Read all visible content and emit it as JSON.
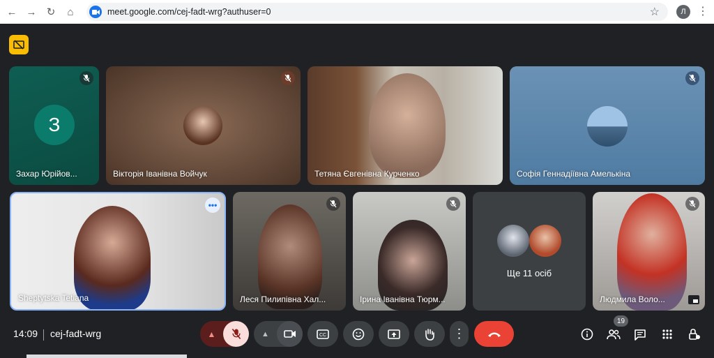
{
  "browser": {
    "url": "meet.google.com/cej-fadt-wrg?authuser=0",
    "profile_initial": "Л"
  },
  "tiles": [
    {
      "name": "Захар Юрійов...",
      "initial": "З"
    },
    {
      "name": "Вікторія Іванівна Войчук"
    },
    {
      "name": "Тетяна Євгенівна Курченко"
    },
    {
      "name": "Софія Геннадіївна Амелькіна"
    },
    {
      "name": "Sheptytska Tetiana"
    },
    {
      "name": "Леся Пилипівна Хал..."
    },
    {
      "name": "Ірина Іванівна Тюрм..."
    },
    {
      "more_label": "Ще 11 осіб"
    },
    {
      "name": "Людмила Воло..."
    }
  ],
  "footer": {
    "time": "14:09",
    "meeting_code": "cej-fadt-wrg",
    "participant_count": "19"
  },
  "colors": {
    "end_call": "#ea4335",
    "mic_off_bg": "#f9dedc",
    "accent": "#fbbc04"
  }
}
